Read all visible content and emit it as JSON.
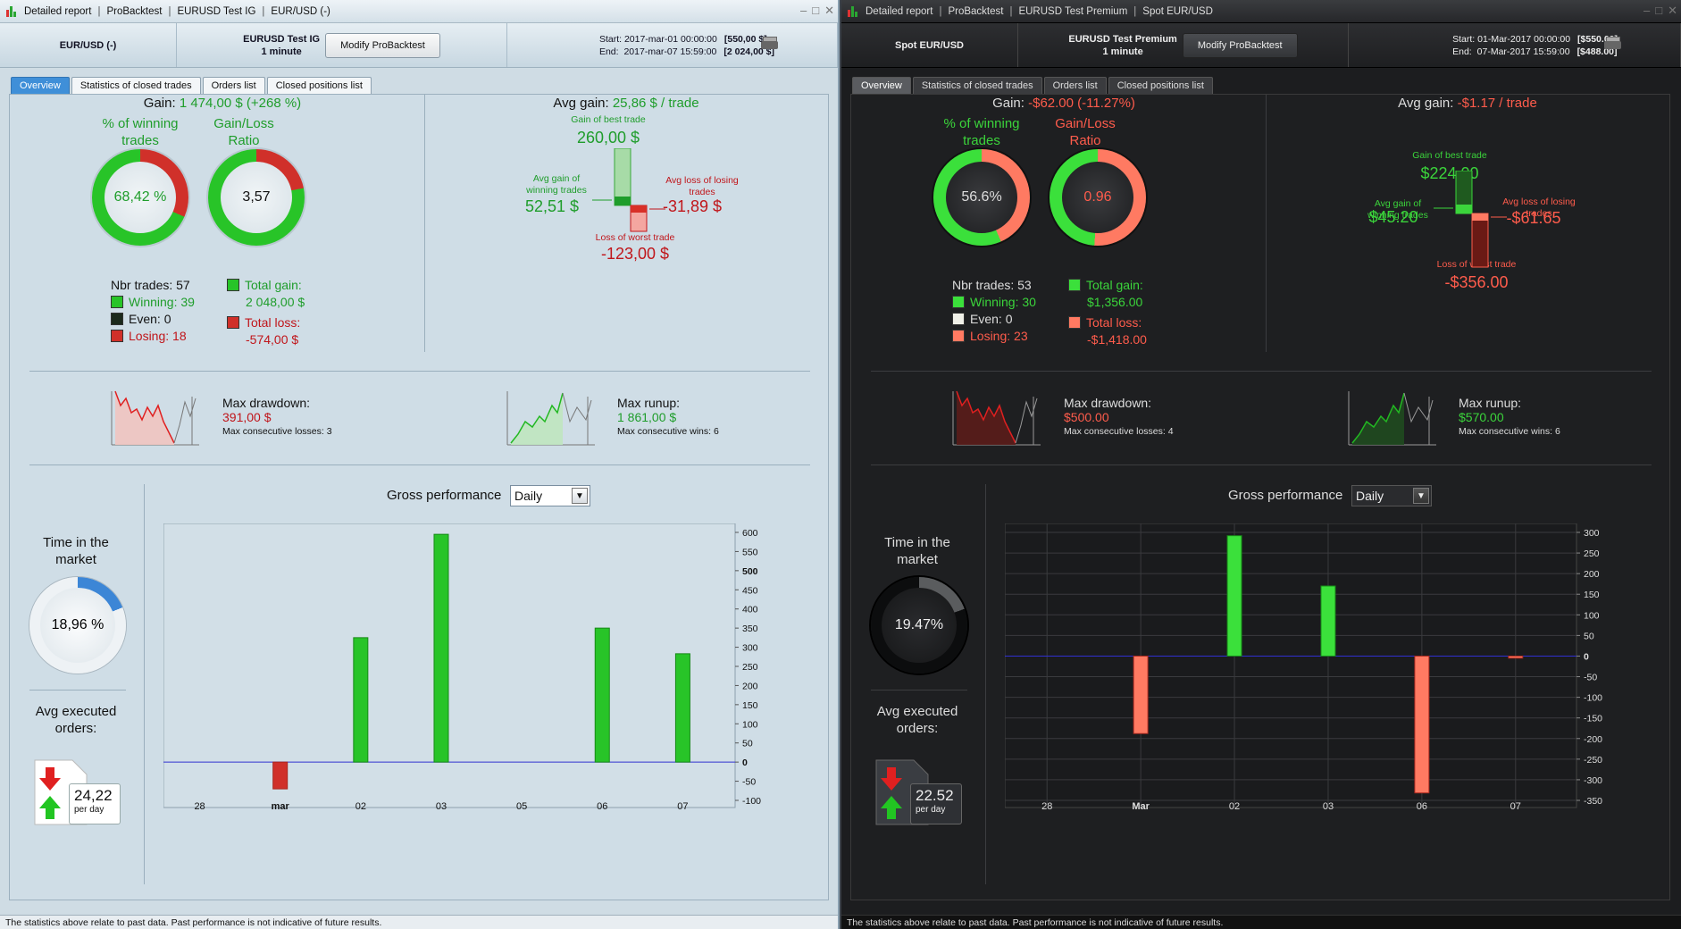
{
  "windows": [
    {
      "id": "left",
      "titlebar": {
        "app": "Detailed report",
        "t1": "ProBacktest",
        "t2": "EURUSD Test IG",
        "t3": "EUR/USD (-)"
      },
      "header": {
        "instrument": "EUR/USD (-)",
        "test_name": "EURUSD Test IG",
        "timeframe": "1 minute",
        "modify_label": "Modify ProBacktest",
        "start_label": "Start:",
        "start": "2017-mar-01 00:00:00",
        "start_capital": "[550,00 $]",
        "end_label": "End:",
        "end": "2017-mar-07 15:59:00",
        "end_capital": "[2 024,00 $]"
      },
      "tabs": [
        "Overview",
        "Statistics of closed trades",
        "Orders list",
        "Closed positions list"
      ],
      "overview": {
        "gain_label": "Gain:",
        "gain_value": "1 474,00 $ (+268 %)",
        "pct_win_label": "% of winning trades",
        "pct_win_value": "68,42 %",
        "pct_win_fraction": 0.6842,
        "gl_ratio_label": "Gain/Loss Ratio",
        "gl_ratio_value": "3,57",
        "gl_ratio_fraction": 0.7811,
        "nbr_trades": "Nbr trades: 57",
        "winning": "Winning: 39",
        "even": "Even: 0",
        "losing": "Losing: 18",
        "total_gain_label": "Total gain:",
        "total_gain": "2 048,00 $",
        "total_loss_label": "Total loss:",
        "total_loss": "-574,00 $",
        "avg_gain_label": "Avg gain:",
        "avg_gain_value": "25,86 $ / trade",
        "best_trade_label": "Gain of best trade",
        "best_trade": "260,00 $",
        "avg_win_label": "Avg gain of winning trades",
        "avg_win": "52,51 $",
        "avg_loss_label": "Avg loss of losing trades",
        "avg_loss": "-31,89 $",
        "worst_trade_label": "Loss of worst trade",
        "worst_trade": "-123,00 $",
        "max_drawdown_label": "Max drawdown:",
        "max_drawdown": "391,00 $",
        "max_cons_losses": "Max consecutive losses: 3",
        "max_runup_label": "Max runup:",
        "max_runup": "1 861,00 $",
        "max_cons_wins": "Max consecutive wins: 6",
        "time_market_label": "Time in the market",
        "time_market_value": "18,96 %",
        "time_market_fraction": 0.1896,
        "avg_orders_label": "Avg executed orders:",
        "avg_orders_value": "24,22",
        "avg_orders_unit": "per day",
        "gross_perf_label": "Gross performance",
        "gross_perf_select": "Daily"
      },
      "status": "The statistics above relate to past data. Past performance is not indicative of future results.",
      "colors": {
        "win": "#28c428",
        "loss": "#d0302a",
        "bg": "#cfdde6"
      }
    },
    {
      "id": "right",
      "titlebar": {
        "app": "Detailed report",
        "t1": "ProBacktest",
        "t2": "EURUSD Test Premium",
        "t3": "Spot EUR/USD"
      },
      "header": {
        "instrument": "Spot EUR/USD",
        "test_name": "EURUSD Test Premium",
        "timeframe": "1 minute",
        "modify_label": "Modify ProBacktest",
        "start_label": "Start:",
        "start": "01-Mar-2017 00:00:00",
        "start_capital": "[$550.00]",
        "end_label": "End:",
        "end": "07-Mar-2017 15:59:00",
        "end_capital": "[$488.00]"
      },
      "tabs": [
        "Overview",
        "Statistics of closed trades",
        "Orders list",
        "Closed positions list"
      ],
      "overview": {
        "gain_label": "Gain:",
        "gain_value": "-$62.00 (-11.27%)",
        "pct_win_label": "% of winning trades",
        "pct_win_value": "56.6%",
        "pct_win_fraction": 0.566,
        "gl_ratio_label": "Gain/Loss Ratio",
        "gl_ratio_value": "0.96",
        "gl_ratio_fraction": 0.4888,
        "nbr_trades": "Nbr trades: 53",
        "winning": "Winning: 30",
        "even": "Even: 0",
        "losing": "Losing: 23",
        "total_gain_label": "Total gain:",
        "total_gain": "$1,356.00",
        "total_loss_label": "Total loss:",
        "total_loss": "-$1,418.00",
        "avg_gain_label": "Avg gain:",
        "avg_gain_value": "-$1.17 / trade",
        "best_trade_label": "Gain of best trade",
        "best_trade": "$224.00",
        "avg_win_label": "Avg gain of winning trades",
        "avg_win": "$45.20",
        "avg_loss_label": "Avg loss of losing trades",
        "avg_loss": "-$61.65",
        "worst_trade_label": "Loss of worst trade",
        "worst_trade": "-$356.00",
        "max_drawdown_label": "Max drawdown:",
        "max_drawdown": "$500.00",
        "max_cons_losses": "Max consecutive losses: 4",
        "max_runup_label": "Max runup:",
        "max_runup": "$570.00",
        "max_cons_wins": "Max consecutive wins: 6",
        "time_market_label": "Time in the market",
        "time_market_value": "19.47%",
        "time_market_fraction": 0.1947,
        "avg_orders_label": "Avg executed orders:",
        "avg_orders_value": "22.52",
        "avg_orders_unit": "per day",
        "gross_perf_label": "Gross performance",
        "gross_perf_select": "Daily"
      },
      "status": "The statistics above relate to past data. Past performance is not indicative of future results.",
      "colors": {
        "win": "#3be03b",
        "loss": "#ff7a62",
        "bg": "#1e1f21"
      }
    }
  ],
  "chart_data": [
    {
      "type": "bar",
      "categories": [
        "28",
        "mar",
        "02",
        "03",
        "05",
        "06",
        "07"
      ],
      "values": [
        0,
        -70,
        325,
        595,
        0,
        350,
        283
      ],
      "yticks": [
        -100,
        -50,
        0,
        50,
        100,
        150,
        200,
        250,
        300,
        350,
        400,
        450,
        500,
        550,
        600
      ],
      "ylim": [
        -100,
        600
      ],
      "grid": false
    },
    {
      "type": "bar",
      "categories": [
        "28",
        "Mar",
        "02",
        "03",
        "06",
        "07"
      ],
      "values": [
        0,
        -188,
        292,
        170,
        -332,
        -5
      ],
      "yticks": [
        -350,
        -300,
        -250,
        -200,
        -150,
        -100,
        -50,
        0,
        50,
        100,
        150,
        200,
        250,
        300
      ],
      "ylim": [
        -350,
        300
      ],
      "grid": true
    }
  ]
}
